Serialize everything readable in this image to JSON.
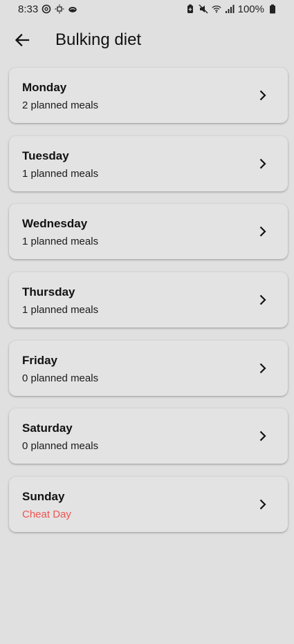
{
  "status_bar": {
    "time": "8:33",
    "battery_text": "100%",
    "icons_left": [
      "threads-icon",
      "brightness-icon",
      "cloud-icon"
    ],
    "icons_right": [
      "battery-saver-icon",
      "mute-icon",
      "wifi-icon",
      "signal-icon",
      "battery-icon"
    ]
  },
  "header": {
    "title": "Bulking diet",
    "back_icon": "arrow-left-icon"
  },
  "days": [
    {
      "name": "Monday",
      "subtitle": "2 planned meals",
      "is_cheat": false
    },
    {
      "name": "Tuesday",
      "subtitle": "1 planned meals",
      "is_cheat": false
    },
    {
      "name": "Wednesday",
      "subtitle": "1 planned meals",
      "is_cheat": false
    },
    {
      "name": "Thursday",
      "subtitle": "1 planned meals",
      "is_cheat": false
    },
    {
      "name": "Friday",
      "subtitle": "0 planned meals",
      "is_cheat": false
    },
    {
      "name": "Saturday",
      "subtitle": "0 planned meals",
      "is_cheat": false
    },
    {
      "name": "Sunday",
      "subtitle": "Cheat Day",
      "is_cheat": true
    }
  ],
  "colors": {
    "background": "#e0e0e0",
    "card": "#e3e3e3",
    "cheat_day": "#ef5350"
  }
}
